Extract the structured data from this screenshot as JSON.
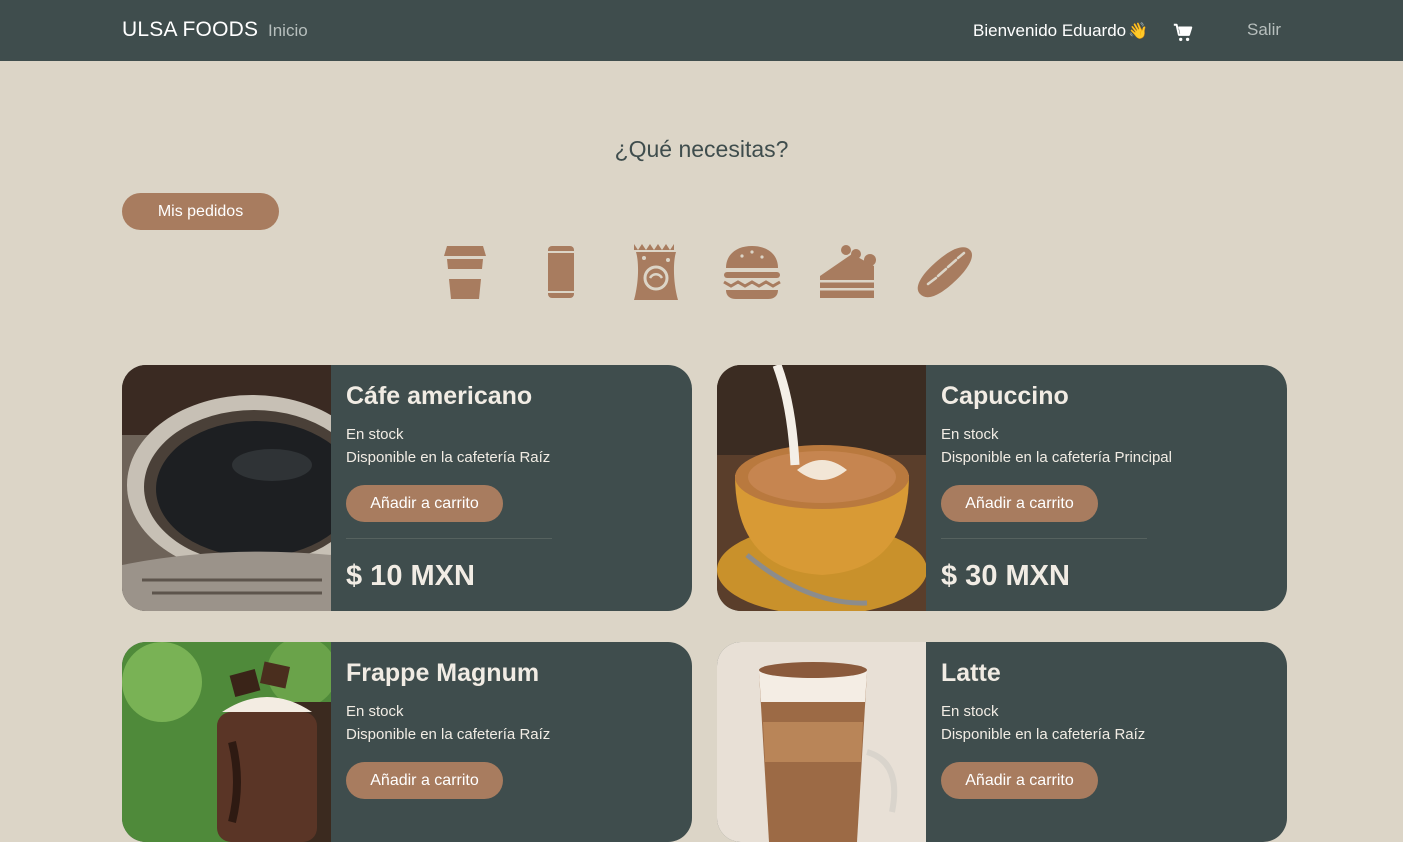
{
  "navbar": {
    "brand": "ULSA FOODS",
    "home_link": "Inicio",
    "welcome": "Bienvenido Eduardo",
    "wave_emoji": "👋",
    "cart_icon": "cart-icon",
    "logout": "Salir"
  },
  "main": {
    "heading": "¿Qué necesitas?",
    "orders_button": "Mis pedidos",
    "categories": [
      {
        "icon": "coffee-cup-icon"
      },
      {
        "icon": "soda-can-icon"
      },
      {
        "icon": "snack-bag-icon"
      },
      {
        "icon": "burger-icon"
      },
      {
        "icon": "cake-slice-icon"
      },
      {
        "icon": "baguette-icon"
      }
    ]
  },
  "products": [
    {
      "name": "Cáfe americano",
      "stock": "En stock",
      "availability": "Disponible en la cafetería Raíz",
      "button": "Añadir a carrito",
      "price": "$ 10 MXN"
    },
    {
      "name": "Capuccino",
      "stock": "En stock",
      "availability": "Disponible en la cafetería Principal",
      "button": "Añadir a carrito",
      "price": "$ 30 MXN"
    },
    {
      "name": "Frappe Magnum",
      "stock": "En stock",
      "availability": "Disponible en la cafetería Raíz",
      "button": "Añadir a carrito"
    },
    {
      "name": "Latte",
      "stock": "En stock",
      "availability": "Disponible en la cafetería Raíz",
      "button": "Añadir a carrito"
    }
  ],
  "colors": {
    "navbar": "#3f4d4d",
    "background": "#dcd5c7",
    "accent": "#a87c5f",
    "card": "#3f4d4d"
  }
}
